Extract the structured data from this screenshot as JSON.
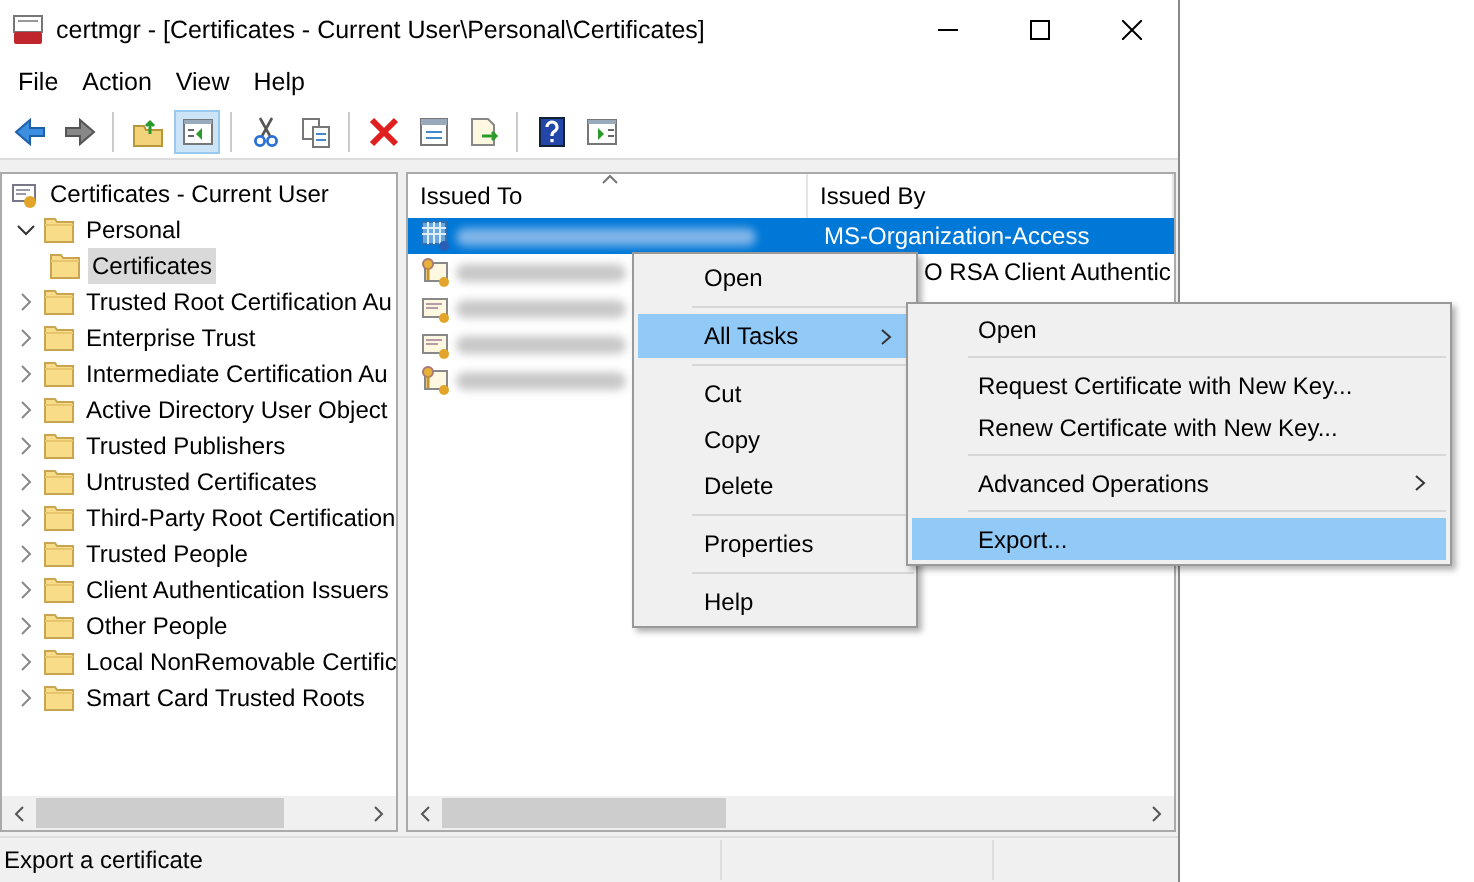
{
  "window": {
    "title": "certmgr - [Certificates - Current User\\Personal\\Certificates]"
  },
  "menu_bar": [
    "File",
    "Action",
    "View",
    "Help"
  ],
  "toolbar": [
    [
      {
        "kind": "back",
        "pressed": false
      },
      {
        "kind": "forward",
        "pressed": false
      }
    ],
    [
      {
        "kind": "up",
        "pressed": false
      },
      {
        "kind": "tree",
        "pressed": true
      }
    ],
    [
      {
        "kind": "cut",
        "pressed": false
      },
      {
        "kind": "copy",
        "pressed": false
      }
    ],
    [
      {
        "kind": "delete",
        "pressed": false
      },
      {
        "kind": "properties",
        "pressed": false
      },
      {
        "kind": "export",
        "pressed": false
      }
    ],
    [
      {
        "kind": "help",
        "pressed": false
      },
      {
        "kind": "action-pane",
        "pressed": false
      }
    ]
  ],
  "tree": {
    "label": "Certificates - Current User",
    "children": [
      {
        "label": "Personal",
        "expanded": true,
        "selected": false,
        "children": [
          {
            "label": "Certificates",
            "selected": true
          }
        ]
      },
      {
        "label": "Trusted Root Certification Au",
        "expanded": false,
        "selected": false
      },
      {
        "label": "Enterprise Trust",
        "expanded": false,
        "selected": false
      },
      {
        "label": "Intermediate Certification Au",
        "expanded": false,
        "selected": false
      },
      {
        "label": "Active Directory User Object",
        "expanded": false,
        "selected": false
      },
      {
        "label": "Trusted Publishers",
        "expanded": false,
        "selected": false
      },
      {
        "label": "Untrusted Certificates",
        "expanded": false,
        "selected": false
      },
      {
        "label": "Third-Party Root Certification",
        "expanded": false,
        "selected": false
      },
      {
        "label": "Trusted People",
        "expanded": false,
        "selected": false
      },
      {
        "label": "Client Authentication Issuers",
        "expanded": false,
        "selected": false
      },
      {
        "label": "Other People",
        "expanded": false,
        "selected": false
      },
      {
        "label": "Local NonRemovable Certific",
        "expanded": false,
        "selected": false
      },
      {
        "label": "Smart Card Trusted Roots",
        "expanded": false,
        "selected": false
      }
    ]
  },
  "table": {
    "columns": [
      "Issued To",
      "Issued By"
    ],
    "rows": [
      {
        "kind": "device",
        "selected": true,
        "issued_by": "MS-Organization-Access"
      },
      {
        "kind": "key",
        "selected": false,
        "issued_by": "O RSA Client Authentic"
      },
      {
        "kind": "plain",
        "selected": false
      },
      {
        "kind": "plain",
        "selected": false
      },
      {
        "kind": "key",
        "selected": false
      }
    ]
  },
  "context_menu": [
    {
      "kind": "item",
      "label": "Open",
      "selected": false
    },
    {
      "kind": "separator"
    },
    {
      "kind": "submenu",
      "label": "All Tasks",
      "selected": true
    },
    {
      "kind": "separator"
    },
    {
      "kind": "item",
      "label": "Cut",
      "selected": false
    },
    {
      "kind": "item",
      "label": "Copy",
      "selected": false
    },
    {
      "kind": "item",
      "label": "Delete",
      "selected": false
    },
    {
      "kind": "separator"
    },
    {
      "kind": "item",
      "label": "Properties",
      "selected": false
    },
    {
      "kind": "separator"
    },
    {
      "kind": "item",
      "label": "Help",
      "selected": false
    }
  ],
  "submenu": [
    {
      "kind": "item",
      "label": "Open",
      "selected": false
    },
    {
      "kind": "separator"
    },
    {
      "kind": "item",
      "label": "Request Certificate with New Key...",
      "selected": false
    },
    {
      "kind": "item",
      "label": "Renew Certificate with New Key...",
      "selected": false
    },
    {
      "kind": "separator"
    },
    {
      "kind": "submenu",
      "label": "Advanced Operations",
      "selected": false
    },
    {
      "kind": "separator"
    },
    {
      "kind": "item",
      "label": "Export...",
      "selected": true
    }
  ],
  "status_bar": [
    "Export a certificate"
  ]
}
